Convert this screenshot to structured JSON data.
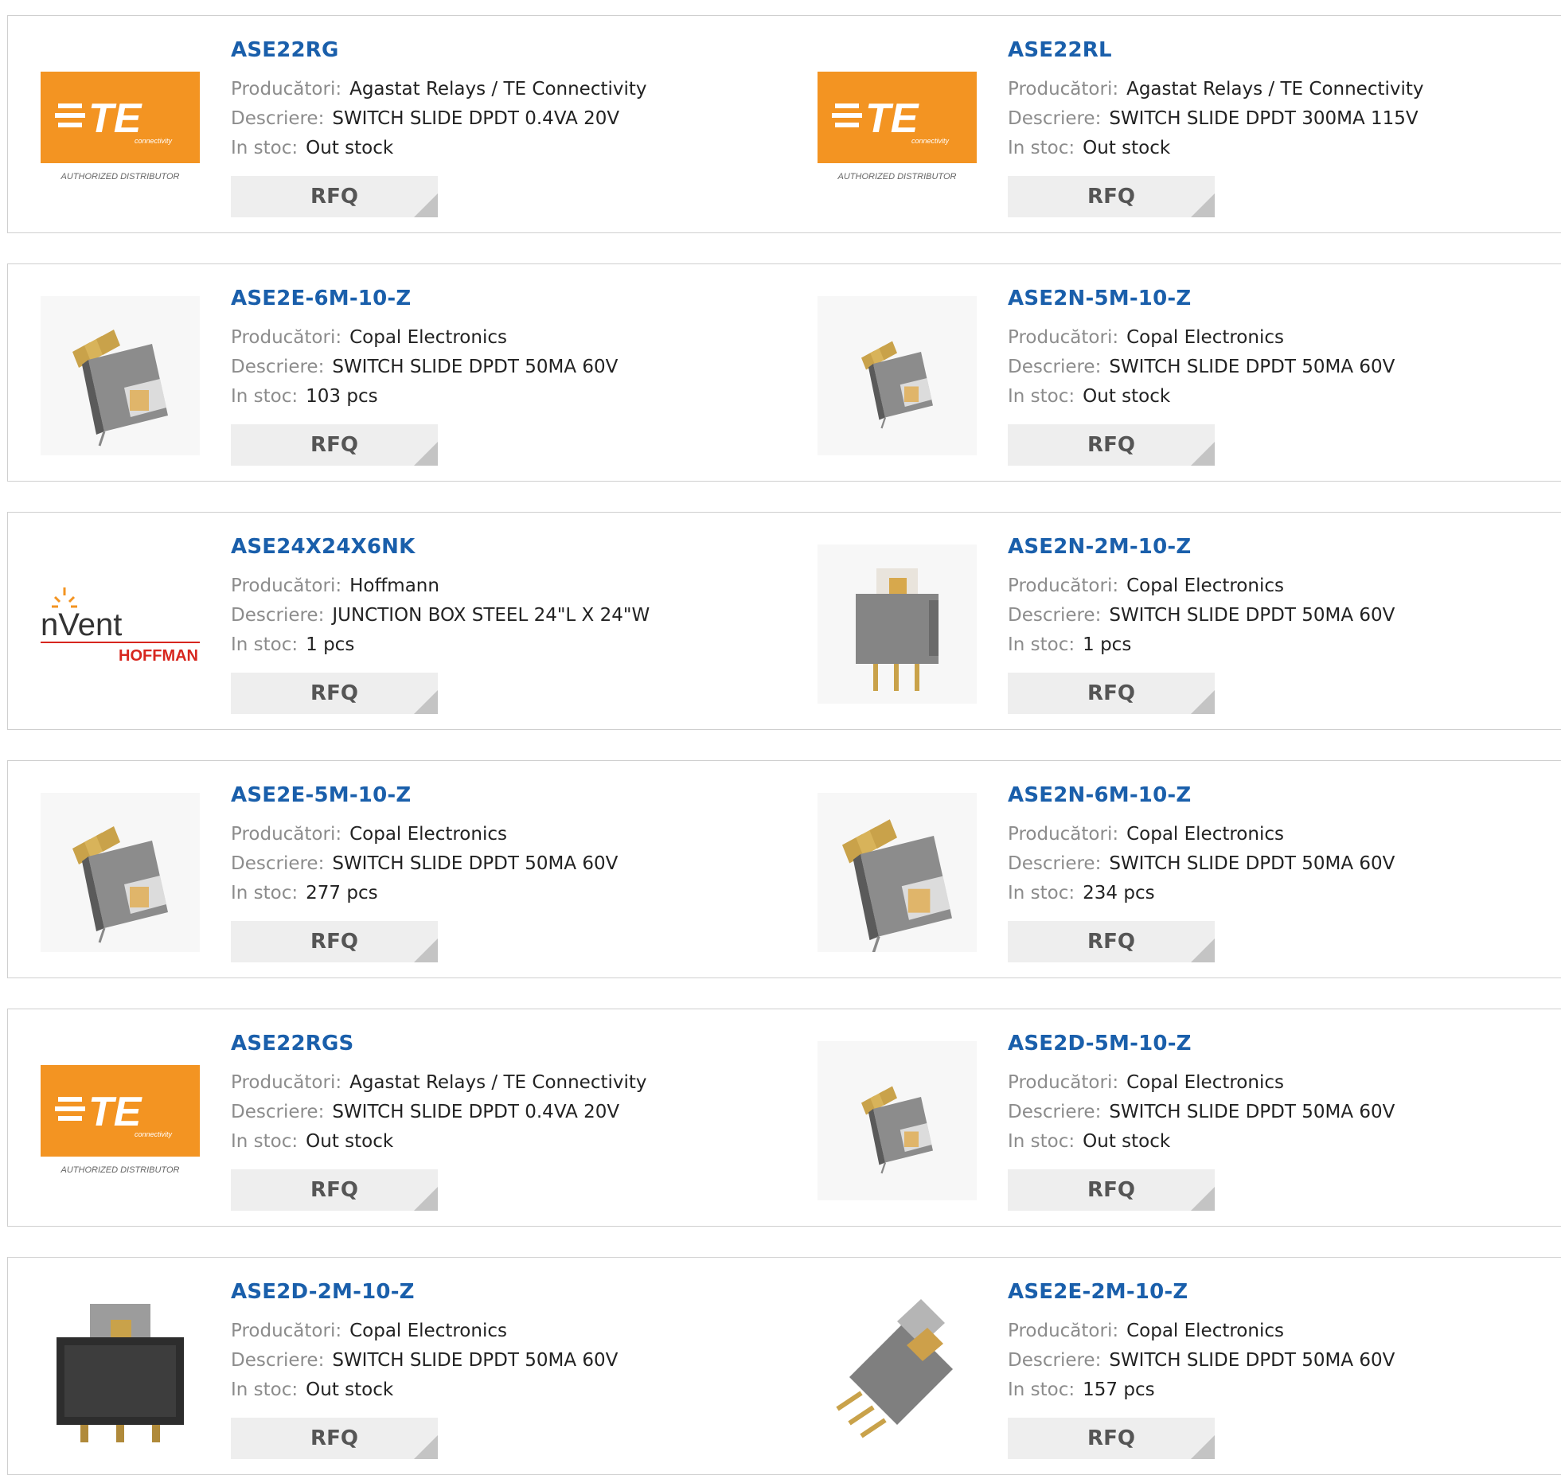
{
  "colors": {
    "link": "#1a5fab",
    "label": "#8c8c8c",
    "value": "#222222",
    "border": "#cfcfcf",
    "button_bg": "#eeeeee",
    "button_corner": "#c4c4c4",
    "te_orange": "#f39422",
    "hoffman_red": "#d7261e"
  },
  "labels": {
    "manufacturer": "Producători:",
    "description": "Descriere:",
    "stock": "In stoc:",
    "rfq": "RFQ"
  },
  "logos": {
    "te_text": "TE",
    "te_sub": "connectivity",
    "te_caption": "AUTHORIZED DISTRIBUTOR",
    "nvent_text": "nVent",
    "hoffman_text": "HOFFMAN"
  },
  "products": [
    {
      "name": "ASE22RG",
      "manufacturer": "Agastat Relays / TE Connectivity",
      "description": "SWITCH SLIDE DPDT 0.4VA 20V",
      "stock": "Out stock",
      "image": "te-logo"
    },
    {
      "name": "ASE22RL",
      "manufacturer": "Agastat Relays / TE Connectivity",
      "description": "SWITCH SLIDE DPDT 300MA 115V",
      "stock": "Out stock",
      "image": "te-logo"
    },
    {
      "name": "ASE2E-6M-10-Z",
      "manufacturer": "Copal Electronics",
      "description": "SWITCH SLIDE DPDT 50MA 60V",
      "stock": "103 pcs",
      "image": "switch-angled"
    },
    {
      "name": "ASE2N-5M-10-Z",
      "manufacturer": "Copal Electronics",
      "description": "SWITCH SLIDE DPDT 50MA 60V",
      "stock": "Out stock",
      "image": "switch-angled-small"
    },
    {
      "name": "ASE24X24X6NK",
      "manufacturer": "Hoffmann",
      "description": "JUNCTION BOX STEEL 24\"L X 24\"W",
      "stock": "1 pcs",
      "image": "nvent-logo"
    },
    {
      "name": "ASE2N-2M-10-Z",
      "manufacturer": "Copal Electronics",
      "description": "SWITCH SLIDE DPDT 50MA 60V",
      "stock": "1 pcs",
      "image": "switch-vertical"
    },
    {
      "name": "ASE2E-5M-10-Z",
      "manufacturer": "Copal Electronics",
      "description": "SWITCH SLIDE DPDT 50MA 60V",
      "stock": "277 pcs",
      "image": "switch-angled"
    },
    {
      "name": "ASE2N-6M-10-Z",
      "manufacturer": "Copal Electronics",
      "description": "SWITCH SLIDE DPDT 50MA 60V",
      "stock": "234 pcs",
      "image": "switch-angled-large"
    },
    {
      "name": "ASE22RGS",
      "manufacturer": "Agastat Relays / TE Connectivity",
      "description": "SWITCH SLIDE DPDT 0.4VA 20V",
      "stock": "Out stock",
      "image": "te-logo"
    },
    {
      "name": "ASE2D-5M-10-Z",
      "manufacturer": "Copal Electronics",
      "description": "SWITCH SLIDE DPDT 50MA 60V",
      "stock": "Out stock",
      "image": "switch-angled-small"
    },
    {
      "name": "ASE2D-2M-10-Z",
      "manufacturer": "Copal Electronics",
      "description": "SWITCH SLIDE DPDT 50MA 60V",
      "stock": "Out stock",
      "image": "switch-black"
    },
    {
      "name": "ASE2E-2M-10-Z",
      "manufacturer": "Copal Electronics",
      "description": "SWITCH SLIDE DPDT 50MA 60V",
      "stock": "157 pcs",
      "image": "switch-diagonal"
    }
  ]
}
